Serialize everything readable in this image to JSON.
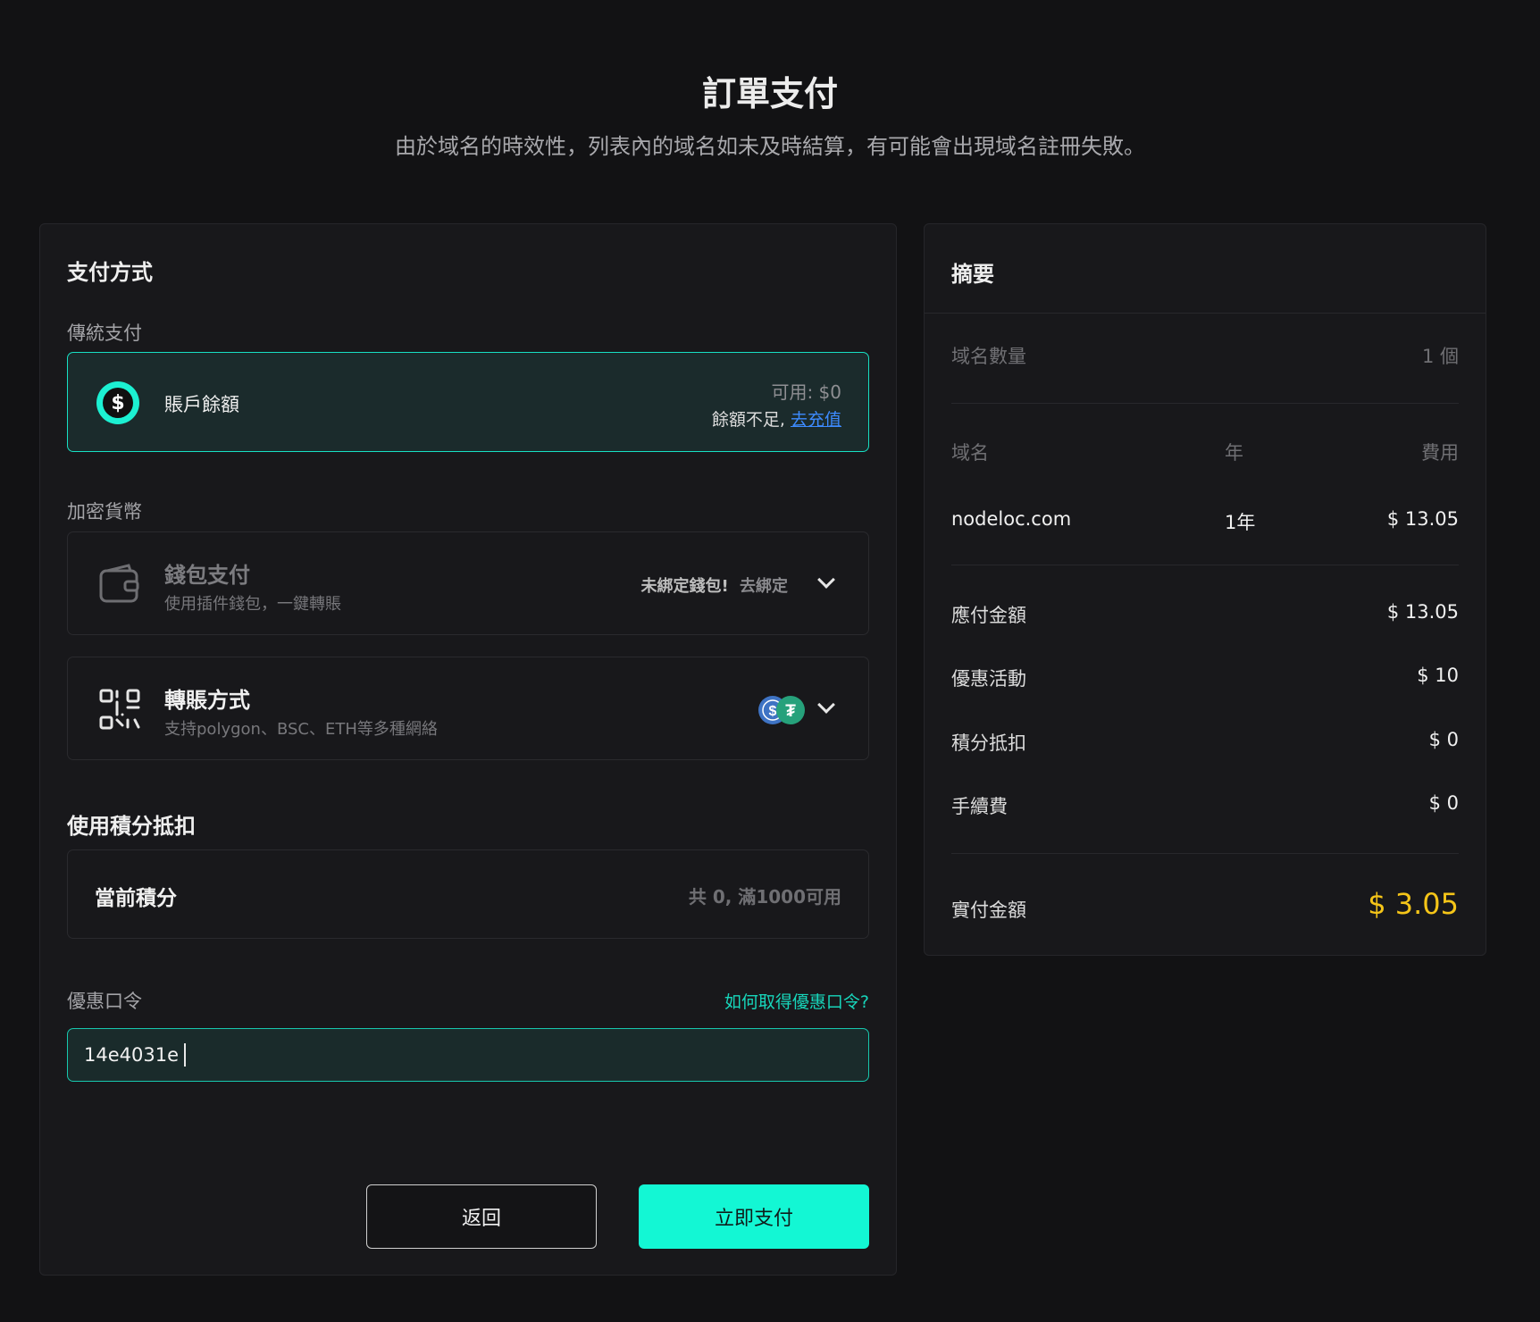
{
  "header": {
    "title": "訂單支付",
    "subtitle": "由於域名的時效性，列表內的域名如未及時結算，有可能會出現域名註冊失敗。"
  },
  "payment": {
    "heading": "支付方式",
    "traditional_label": "傳統支付",
    "balance": {
      "name": "賬戶餘額",
      "available": "可用: $0",
      "insufficient": "餘額不足,",
      "topup_link": "去充值"
    },
    "crypto_label": "加密貨幣",
    "wallet": {
      "title": "錢包支付",
      "subtitle": "使用插件錢包，一鍵轉賬",
      "status": "未綁定錢包!",
      "bind_link": "去綁定"
    },
    "transfer": {
      "title": "轉賬方式",
      "subtitle": "支持polygon、BSC、ETH等多種網絡",
      "coin_icons": [
        "usdc-icon",
        "tether-icon"
      ]
    }
  },
  "points": {
    "heading": "使用積分抵扣",
    "current_label": "當前積分",
    "current_value": "共 0, 滿1000可用"
  },
  "coupon": {
    "label": "優惠口令",
    "help_link": "如何取得優惠口令?",
    "value": "14e4031e"
  },
  "actions": {
    "back": "返回",
    "pay": "立即支付"
  },
  "summary": {
    "heading": "摘要",
    "count_label": "域名數量",
    "count_value": "1 個",
    "table": {
      "headers": [
        "域名",
        "年",
        "費用"
      ],
      "rows": [
        {
          "domain": "nodeloc.com",
          "years": "1年",
          "fee": "$ 13.05"
        }
      ]
    },
    "payable_label": "應付金額",
    "payable_value": "$ 13.05",
    "discount_label": "優惠活動",
    "discount_value": "$ 10",
    "points_label": "積分抵扣",
    "points_value": "$ 0",
    "fee_label": "手續費",
    "fee_value": "$ 0",
    "total_label": "實付金額",
    "total_value": "$ 3.05"
  },
  "colors": {
    "accent": "#13f7d4",
    "total": "#f5c518",
    "link": "#3d8bff",
    "background": "#121214"
  }
}
